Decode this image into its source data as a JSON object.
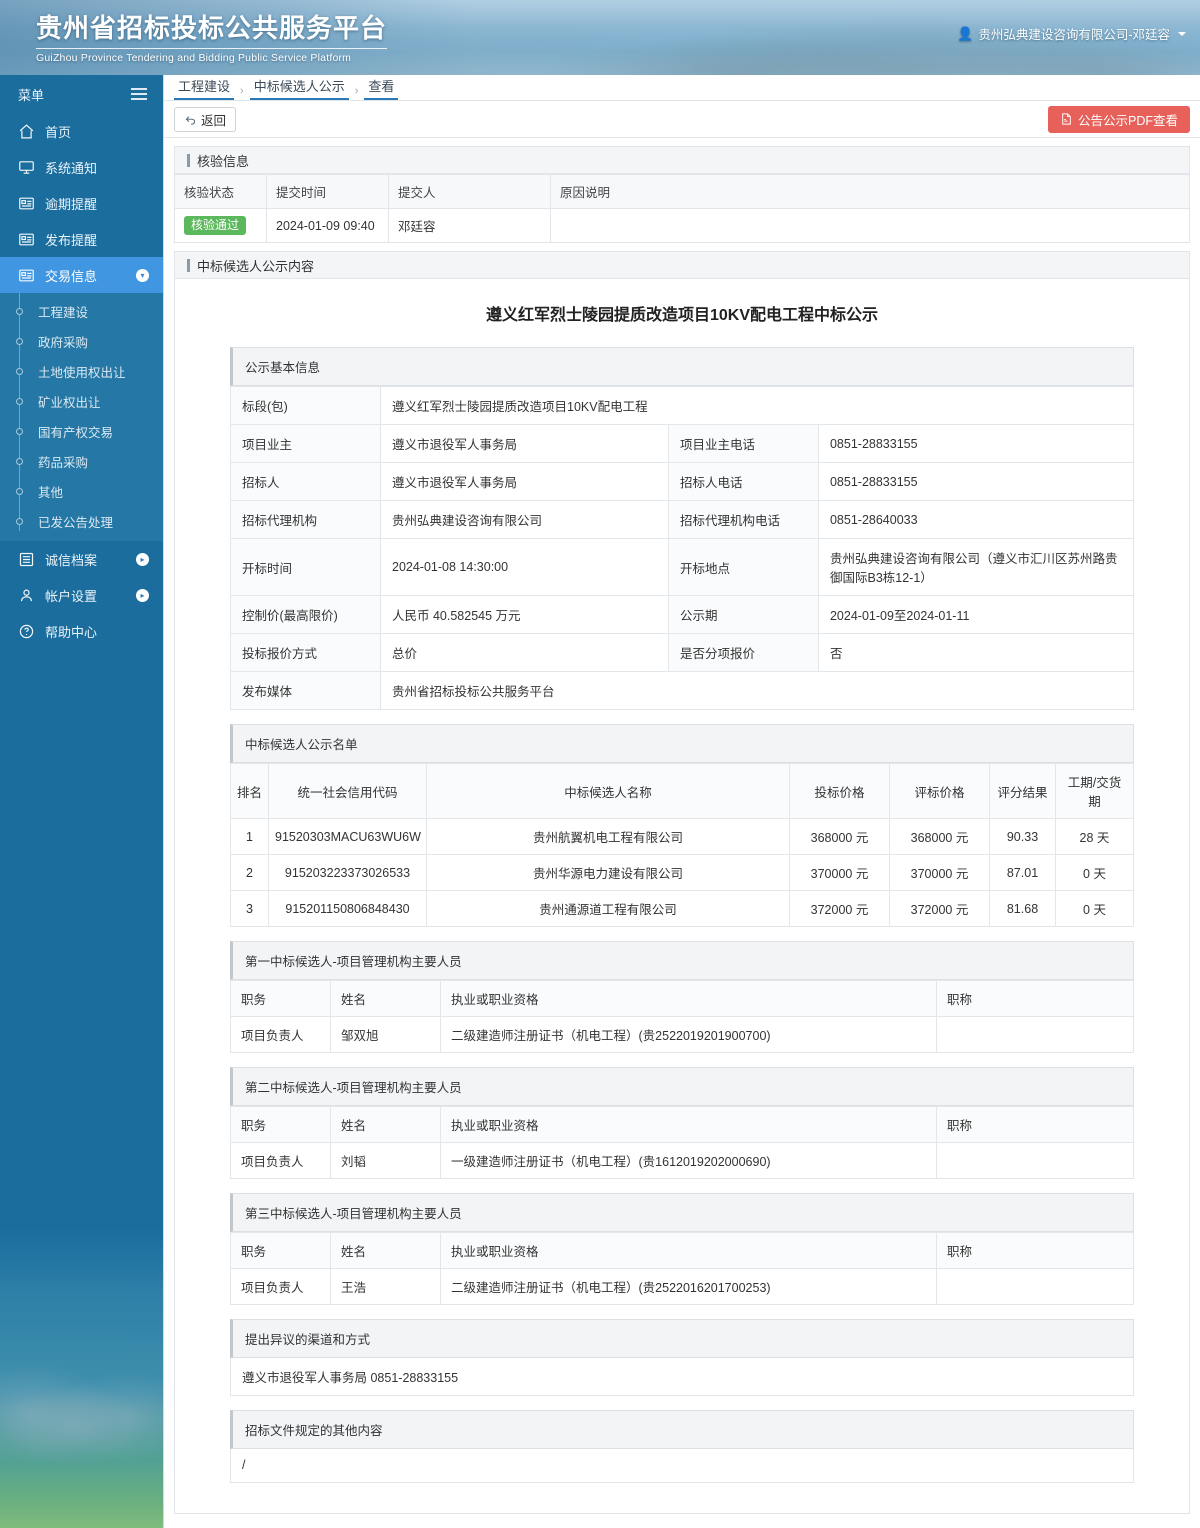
{
  "header": {
    "brand_cn": "贵州省招标投标公共服务平台",
    "brand_en": "GuiZhou Province Tendering and Bidding Public Service Platform",
    "user": "贵州弘典建设咨询有限公司-邓廷容",
    "user_icon": "user-icon"
  },
  "sidebar": {
    "menu_label": "菜单",
    "hamburger_icon": "hamburger-icon",
    "items": [
      {
        "label": "首页",
        "icon": "home-icon",
        "active": false,
        "expandable": false
      },
      {
        "label": "系统通知",
        "icon": "monitor-icon",
        "active": false,
        "expandable": false
      },
      {
        "label": "逾期提醒",
        "icon": "list-card-icon",
        "active": false,
        "expandable": false
      },
      {
        "label": "发布提醒",
        "icon": "list-card-icon",
        "active": false,
        "expandable": false
      },
      {
        "label": "交易信息",
        "icon": "list-card-icon",
        "active": true,
        "expandable": true
      },
      {
        "label": "诚信档案",
        "icon": "archive-icon",
        "active": false,
        "expandable": true
      },
      {
        "label": "帐户设置",
        "icon": "person-icon",
        "active": false,
        "expandable": true
      },
      {
        "label": "帮助中心",
        "icon": "question-circle-icon",
        "active": false,
        "expandable": false
      }
    ],
    "submenu": [
      "工程建设",
      "政府采购",
      "土地使用权出让",
      "矿业权出让",
      "国有产权交易",
      "药品采购",
      "其他",
      "已发公告处理"
    ]
  },
  "breadcrumb": {
    "items": [
      "工程建设",
      "中标候选人公示",
      "查看"
    ],
    "separator": "›"
  },
  "toolbar": {
    "back_label": "返回",
    "back_icon": "undo-arrow-icon",
    "pdf_label": "公告公示PDF查看",
    "pdf_icon": "pdf-file-icon"
  },
  "verify_panel": {
    "title": "核验信息",
    "headers": [
      "核验状态",
      "提交时间",
      "提交人",
      "原因说明"
    ],
    "row": {
      "status": "核验通过",
      "status_color": "#5cb85c",
      "submit_time": "2024-01-09 09:40",
      "submitter": "邓廷容",
      "reason": ""
    }
  },
  "content_panel": {
    "title": "中标候选人公示内容",
    "doc_title": "遵义红军烈士陵园提质改造项目10KV配电工程中标公示"
  },
  "basic_info": {
    "section_title": "公示基本信息",
    "rows": [
      {
        "k1": "标段(包)",
        "v1": "遵义红军烈士陵园提质改造项目10KV配电工程",
        "full": true
      },
      {
        "k1": "项目业主",
        "v1": "遵义市退役军人事务局",
        "k2": "项目业主电话",
        "v2": "0851-28833155"
      },
      {
        "k1": "招标人",
        "v1": "遵义市退役军人事务局",
        "k2": "招标人电话",
        "v2": "0851-28833155"
      },
      {
        "k1": "招标代理机构",
        "v1": "贵州弘典建设咨询有限公司",
        "k2": "招标代理机构电话",
        "v2": "0851-28640033"
      },
      {
        "k1": "开标时间",
        "v1": "2024-01-08 14:30:00",
        "k2": "开标地点",
        "v2": "贵州弘典建设咨询有限公司（遵义市汇川区苏州路贵御国际B3栋12-1）"
      },
      {
        "k1": "控制价(最高限价)",
        "v1": "人民币 40.582545 万元",
        "k2": "公示期",
        "v2": "2024-01-09至2024-01-11"
      },
      {
        "k1": "投标报价方式",
        "v1": "总价",
        "k2": "是否分项报价",
        "v2": "否"
      },
      {
        "k1": "发布媒体",
        "v1": "贵州省招标投标公共服务平台",
        "full": true
      }
    ]
  },
  "candidates": {
    "section_title": "中标候选人公示名单",
    "headers": [
      "排名",
      "统一社会信用代码",
      "中标候选人名称",
      "投标价格",
      "评标价格",
      "评分结果",
      "工期/交货期"
    ],
    "rows": [
      {
        "rank": "1",
        "credit_code": "91520303MACU63WU6W",
        "name": "贵州航翼机电工程有限公司",
        "bid_price": "368000 元",
        "eval_price": "368000 元",
        "score": "90.33",
        "duration": "28 天"
      },
      {
        "rank": "2",
        "credit_code": "915203223373026533",
        "name": "贵州华源电力建设有限公司",
        "bid_price": "370000 元",
        "eval_price": "370000 元",
        "score": "87.01",
        "duration": "0 天"
      },
      {
        "rank": "3",
        "credit_code": "915201150806848430",
        "name": "贵州通源道工程有限公司",
        "bid_price": "372000 元",
        "eval_price": "372000 元",
        "score": "81.68",
        "duration": "0 天"
      }
    ]
  },
  "personnel": {
    "headers": [
      "职务",
      "姓名",
      "执业或职业资格",
      "职称"
    ],
    "groups": [
      {
        "section_title": "第一中标候选人-项目管理机构主要人员",
        "rows": [
          {
            "post": "项目负责人",
            "name": "邹双旭",
            "qualification": "二级建造师注册证书（机电工程）(贵2522019201900700)",
            "title": ""
          }
        ]
      },
      {
        "section_title": "第二中标候选人-项目管理机构主要人员",
        "rows": [
          {
            "post": "项目负责人",
            "name": "刘韬",
            "qualification": "一级建造师注册证书（机电工程）(贵1612019202000690)",
            "title": ""
          }
        ]
      },
      {
        "section_title": "第三中标候选人-项目管理机构主要人员",
        "rows": [
          {
            "post": "项目负责人",
            "name": "王浩",
            "qualification": "二级建造师注册证书（机电工程）(贵2522016201700253)",
            "title": ""
          }
        ]
      }
    ]
  },
  "objection": {
    "section_title": "提出异议的渠道和方式",
    "text": "遵义市退役军人事务局 0851-28833155"
  },
  "other_content": {
    "section_title": "招标文件规定的其他内容",
    "text": "/"
  }
}
